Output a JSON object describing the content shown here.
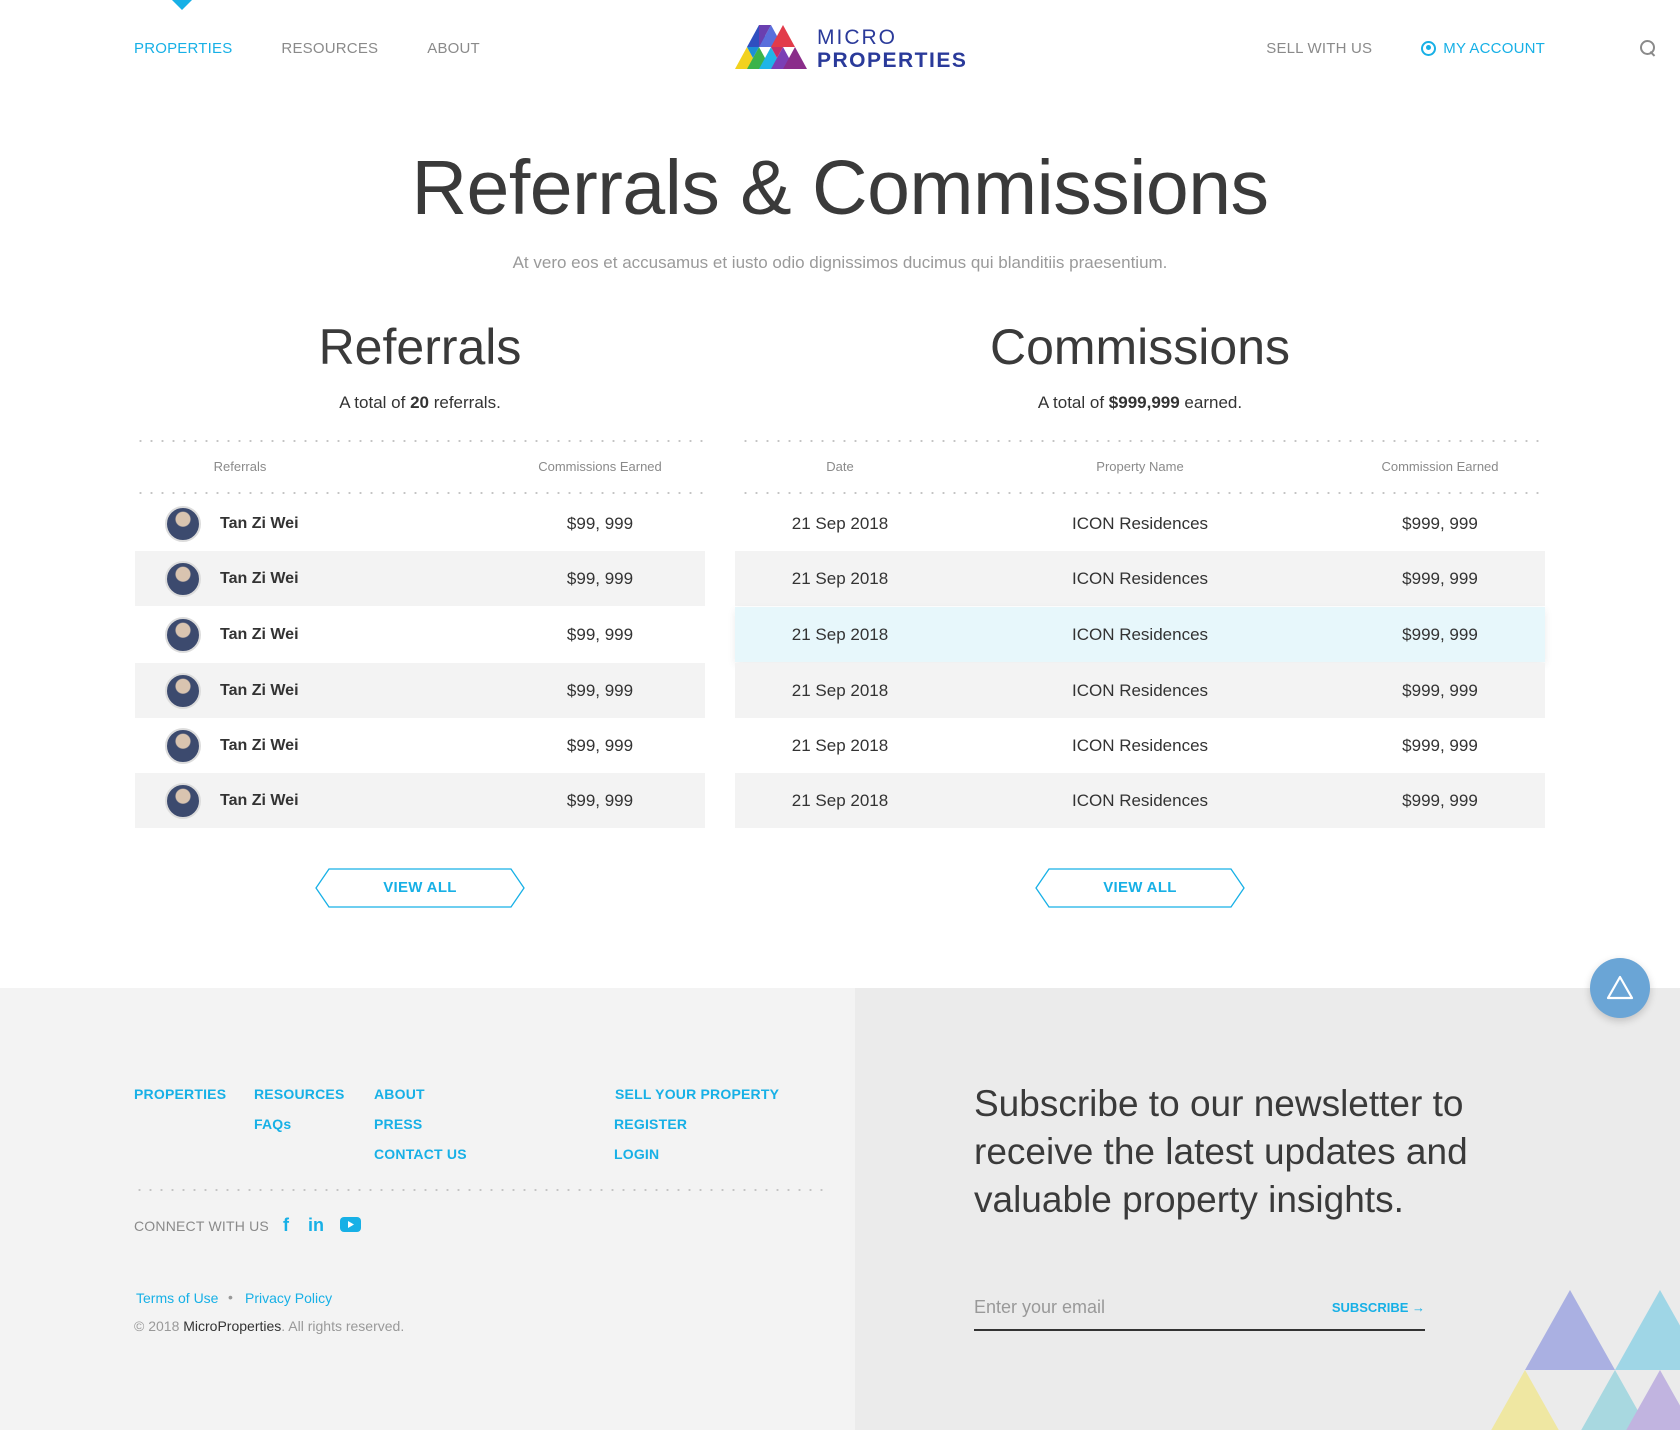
{
  "header": {
    "nav_left": [
      "PROPERTIES",
      "RESOURCES",
      "ABOUT"
    ],
    "logo_top": "MICRO",
    "logo_bottom": "PROPERTIES",
    "sell": "SELL WITH US",
    "account": "MY ACCOUNT"
  },
  "hero": {
    "title": "Referrals & Commissions",
    "subtitle": "At vero eos et accusamus et iusto odio dignissimos ducimus qui blanditiis praesentium."
  },
  "referrals": {
    "title": "Referrals",
    "sub_pre": "A total of ",
    "sub_count": "20",
    "sub_post": " referrals.",
    "headers": [
      "Referrals",
      "Commissions Earned"
    ],
    "rows": [
      {
        "name": "Tan Zi Wei",
        "amount": "$99, 999"
      },
      {
        "name": "Tan Zi Wei",
        "amount": "$99, 999"
      },
      {
        "name": "Tan Zi Wei",
        "amount": "$99, 999"
      },
      {
        "name": "Tan Zi Wei",
        "amount": "$99, 999"
      },
      {
        "name": "Tan Zi Wei",
        "amount": "$99, 999"
      },
      {
        "name": "Tan Zi Wei",
        "amount": "$99, 999"
      }
    ],
    "button": "VIEW ALL"
  },
  "commissions": {
    "title": "Commissions",
    "sub_pre": "A total of ",
    "sub_total": "$999,999",
    "sub_post": " earned.",
    "headers": [
      "Date",
      "Property Name",
      "Commission Earned"
    ],
    "rows": [
      {
        "date": "21 Sep 2018",
        "property": "ICON Residences",
        "amount": "$999, 999"
      },
      {
        "date": "21 Sep 2018",
        "property": "ICON Residences",
        "amount": "$999, 999"
      },
      {
        "date": "21 Sep 2018",
        "property": "ICON Residences",
        "amount": "$999, 999"
      },
      {
        "date": "21 Sep 2018",
        "property": "ICON Residences",
        "amount": "$999, 999"
      },
      {
        "date": "21 Sep 2018",
        "property": "ICON Residences",
        "amount": "$999, 999"
      },
      {
        "date": "21 Sep 2018",
        "property": "ICON Residences",
        "amount": "$999, 999"
      }
    ],
    "button": "VIEW ALL"
  },
  "footer": {
    "links": {
      "properties": "PROPERTIES",
      "resources": "RESOURCES",
      "faqs": "FAQs",
      "about": "ABOUT",
      "press": "PRESS",
      "contact": "CONTACT US",
      "sell": "SELL YOUR PROPERTY",
      "register": "REGISTER",
      "login": "LOGIN"
    },
    "connect": "CONNECT WITH US",
    "social_icons": [
      "facebook-icon",
      "linkedin-icon",
      "youtube-icon"
    ],
    "terms": "Terms of Use",
    "privacy": "Privacy Policy",
    "copy_pre": "© 2018 ",
    "copy_brand": "MicroProperties",
    "copy_post": ". All rights reserved.",
    "newsletter": "Subscribe to our newsletter to receive the latest updates and valuable property insights.",
    "email_placeholder": "Enter your email",
    "subscribe": "SUBSCRIBE →"
  },
  "colors": {
    "accent": "#17b0e6",
    "logo_blue": "#2a3a9a",
    "row_shade": "#f3f3f3",
    "row_highlight": "#e7f7fb"
  }
}
